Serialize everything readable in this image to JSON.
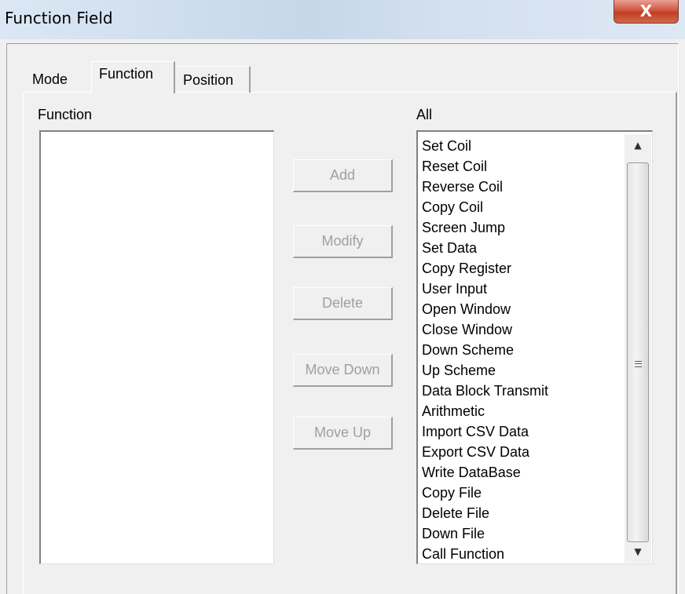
{
  "window": {
    "title": "Function Field",
    "close_glyph": "X"
  },
  "tabs": [
    {
      "label": "Mode",
      "selected": false
    },
    {
      "label": "Function",
      "selected": true
    },
    {
      "label": "Position",
      "selected": false
    }
  ],
  "function_panel": {
    "label": "Function",
    "items": []
  },
  "buttons": {
    "add": "Add",
    "modify": "Modify",
    "delete": "Delete",
    "move_down": "Move Down",
    "move_up": "Move Up",
    "state": "disabled"
  },
  "all_panel": {
    "label": "All",
    "items": [
      "Set Coil",
      "Reset Coil",
      "Reverse Coil",
      "Copy Coil",
      "Screen Jump",
      "Set Data",
      "Copy Register",
      "User Input",
      "Open Window",
      "Close Window",
      "Down Scheme",
      "Up Scheme",
      "Data Block Transmit",
      "Arithmetic",
      "Import CSV Data",
      "Export CSV Data",
      "Write DataBase",
      "Copy File",
      "Delete File",
      "Down File",
      "Call Function"
    ],
    "scrollbar": {
      "up_icon": "scroll-up-arrow",
      "down_icon": "scroll-down-arrow"
    }
  },
  "colors": {
    "titlebar": "#c6d7ea",
    "close_button": "#c23d22",
    "dialog_background": "#f0f0f0",
    "disabled_text": "#a0a0a0"
  }
}
